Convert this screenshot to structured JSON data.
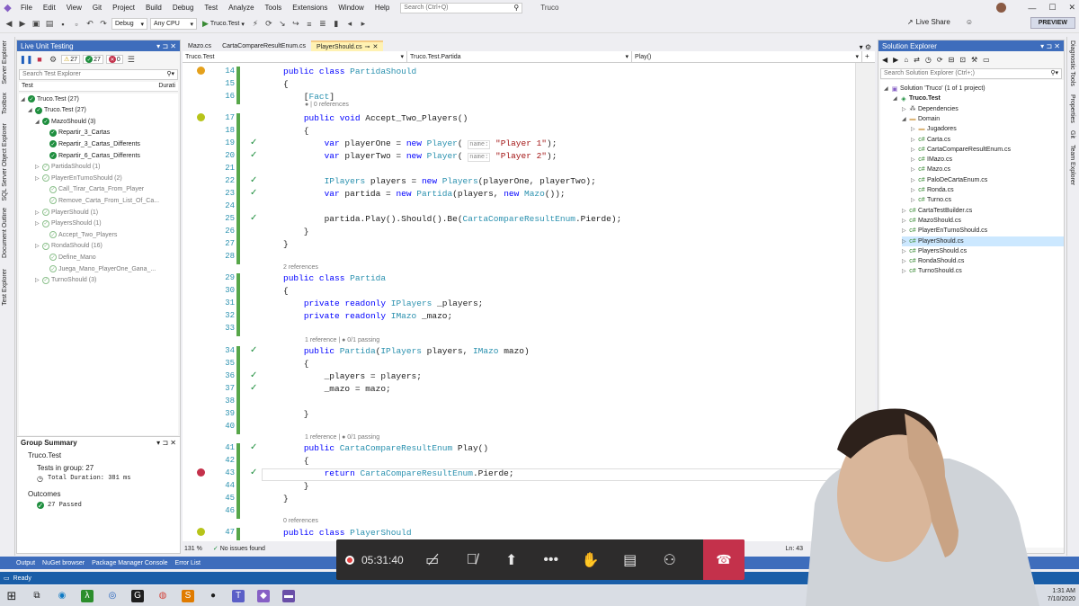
{
  "menubar": {
    "items": [
      "File",
      "Edit",
      "View",
      "Git",
      "Project",
      "Build",
      "Debug",
      "Test",
      "Analyze",
      "Tools",
      "Extensions",
      "Window",
      "Help"
    ],
    "search_placeholder": "Search (Ctrl+Q)",
    "solution": "Truco"
  },
  "toolbar": {
    "config": "Debug",
    "platform": "Any CPU",
    "run_target": "Truco.Test",
    "live_share": "Live Share",
    "preview": "PREVIEW"
  },
  "left_strip": [
    "Server Explorer",
    "Toolbox",
    "SQL Server Object Explorer",
    "Document Outline",
    "Test Explorer"
  ],
  "right_strip": [
    "Diagnostic Tools",
    "Properties",
    "Git",
    "Team Explorer"
  ],
  "lut": {
    "title": "Live Unit Testing",
    "counts": {
      "warn": "27",
      "pass": "27",
      "fail": "0"
    },
    "search_placeholder": "Search Test Explorer",
    "col_test": "Test",
    "col_duration": "Durati",
    "tree": [
      {
        "label": "Truco.Test (27)",
        "level": 0,
        "faded": false
      },
      {
        "label": "Truco.Test (27)",
        "level": 1,
        "faded": false
      },
      {
        "label": "MazoShould (3)",
        "level": 2,
        "faded": false
      },
      {
        "label": "Repartir_3_Cartas",
        "level": 3,
        "faded": false
      },
      {
        "label": "Repartir_3_Cartas_Differents",
        "level": 3,
        "faded": false
      },
      {
        "label": "Repartir_6_Cartas_Differents",
        "level": 3,
        "faded": false
      },
      {
        "label": "PartidaShould (1)",
        "level": 2,
        "faded": true
      },
      {
        "label": "PlayerEnTurnoShould (2)",
        "level": 2,
        "faded": true
      },
      {
        "label": "Call_Tirar_Carta_From_Player",
        "level": 3,
        "faded": true
      },
      {
        "label": "Remove_Carta_From_List_Of_Ca...",
        "level": 3,
        "faded": true
      },
      {
        "label": "PlayerShould (1)",
        "level": 2,
        "faded": true
      },
      {
        "label": "PlayersShould (1)",
        "level": 2,
        "faded": true
      },
      {
        "label": "Accept_Two_Players",
        "level": 3,
        "faded": true
      },
      {
        "label": "RondaShould (16)",
        "level": 2,
        "faded": true
      },
      {
        "label": "Define_Mano",
        "level": 3,
        "faded": true
      },
      {
        "label": "Juega_Mano_PlayerOne_Gana_...",
        "level": 3,
        "faded": true
      },
      {
        "label": "TurnoShould (3)",
        "level": 2,
        "faded": true
      }
    ],
    "summary": {
      "title": "Group Summary",
      "group": "Truco.Test",
      "tests_in_group": "Tests in group: 27",
      "duration": "Total Duration: 381 ms",
      "outcomes": "Outcomes",
      "passed": "27 Passed"
    }
  },
  "doc_tabs": [
    "Mazo.cs",
    "CartaCompareResultEnum.cs",
    "PlayerShould.cs"
  ],
  "nav": {
    "project": "Truco.Test",
    "class": "Truco.Test.Partida",
    "member": "Play()"
  },
  "code": [
    {
      "ln": "14",
      "html": "public class PartidaShould"
    },
    {
      "ln": "15",
      "html": "{"
    },
    {
      "ln": "16",
      "html": "    [Fact]"
    },
    {
      "ln": "17",
      "html": "    public void Accept_Two_Players()"
    },
    {
      "ln": "18",
      "html": "    {"
    },
    {
      "ln": "19",
      "html": "        var playerOne = new Player( name: \"Player 1\");"
    },
    {
      "ln": "20",
      "html": "        var playerTwo = new Player( name: \"Player 2\");"
    },
    {
      "ln": "21",
      "html": ""
    },
    {
      "ln": "22",
      "html": "        IPlayers players = new Players(playerOne, playerTwo);"
    },
    {
      "ln": "23",
      "html": "        var partida = new Partida(players, new Mazo());"
    },
    {
      "ln": "24",
      "html": ""
    },
    {
      "ln": "25",
      "html": "        partida.Play().Should().Be(CartaCompareResultEnum.Pierde);"
    },
    {
      "ln": "26",
      "html": "    }"
    },
    {
      "ln": "27",
      "html": "}"
    },
    {
      "ln": "28",
      "html": ""
    },
    {
      "ln": "29",
      "html": "public class Partida"
    },
    {
      "ln": "30",
      "html": "{"
    },
    {
      "ln": "31",
      "html": "    private readonly IPlayers _players;"
    },
    {
      "ln": "32",
      "html": "    private readonly IMazo _mazo;"
    },
    {
      "ln": "33",
      "html": ""
    },
    {
      "ln": "34",
      "html": "    public Partida(IPlayers players, IMazo mazo)"
    },
    {
      "ln": "35",
      "html": "    {"
    },
    {
      "ln": "36",
      "html": "        _players = players;"
    },
    {
      "ln": "37",
      "html": "        _mazo = mazo;"
    },
    {
      "ln": "38",
      "html": ""
    },
    {
      "ln": "39",
      "html": "    }"
    },
    {
      "ln": "40",
      "html": ""
    },
    {
      "ln": "41",
      "html": "    public CartaCompareResultEnum Play()"
    },
    {
      "ln": "42",
      "html": "    {"
    },
    {
      "ln": "43",
      "html": "        return CartaCompareResultEnum.Pierde;"
    },
    {
      "ln": "44",
      "html": "    }"
    },
    {
      "ln": "45",
      "html": "}"
    },
    {
      "ln": "46",
      "html": ""
    },
    {
      "ln": "47",
      "html": "public class PlayerShould"
    }
  ],
  "lenses": {
    "l16": "● | 0 references",
    "l29": "2 references",
    "l34": "1 reference | ● 0/1 passing",
    "l41": "1 reference | ● 0/1 passing",
    "l47": "0 references"
  },
  "editor_status": {
    "zoom": "131 %",
    "issues": "No issues found",
    "line": "Ln: 43"
  },
  "solution_explorer": {
    "title": "Solution Explorer",
    "search_placeholder": "Search Solution Explorer (Ctrl+;)",
    "tree": [
      {
        "label": "Solution 'Truco' (1 of 1 project)",
        "level": 0,
        "icon": "solution",
        "sel": false
      },
      {
        "label": "Truco.Test",
        "level": 1,
        "icon": "project",
        "sel": false,
        "bold": true
      },
      {
        "label": "Dependencies",
        "level": 2,
        "icon": "deps",
        "sel": false
      },
      {
        "label": "Domain",
        "level": 2,
        "icon": "folder",
        "sel": false
      },
      {
        "label": "Jugadores",
        "level": 3,
        "icon": "folder",
        "sel": false
      },
      {
        "label": "Carta.cs",
        "level": 3,
        "icon": "cs",
        "sel": false
      },
      {
        "label": "CartaCompareResultEnum.cs",
        "level": 3,
        "icon": "cs",
        "sel": false
      },
      {
        "label": "IMazo.cs",
        "level": 3,
        "icon": "cs",
        "sel": false
      },
      {
        "label": "Mazo.cs",
        "level": 3,
        "icon": "cs",
        "sel": false
      },
      {
        "label": "PaloDeCartaEnum.cs",
        "level": 3,
        "icon": "cs",
        "sel": false
      },
      {
        "label": "Ronda.cs",
        "level": 3,
        "icon": "cs",
        "sel": false
      },
      {
        "label": "Turno.cs",
        "level": 3,
        "icon": "cs",
        "sel": false
      },
      {
        "label": "CartaTestBuilder.cs",
        "level": 2,
        "icon": "cs",
        "sel": false
      },
      {
        "label": "MazoShould.cs",
        "level": 2,
        "icon": "cs",
        "sel": false
      },
      {
        "label": "PlayerEnTurnoShould.cs",
        "level": 2,
        "icon": "cs",
        "sel": false
      },
      {
        "label": "PlayerShould.cs",
        "level": 2,
        "icon": "cs",
        "sel": true
      },
      {
        "label": "PlayersShould.cs",
        "level": 2,
        "icon": "cs",
        "sel": false
      },
      {
        "label": "RondaShould.cs",
        "level": 2,
        "icon": "cs",
        "sel": false
      },
      {
        "label": "TurnoShould.cs",
        "level": 2,
        "icon": "cs",
        "sel": false
      }
    ]
  },
  "bottom_tabs": [
    "Output",
    "NuGet browser",
    "Package Manager Console",
    "Error List"
  ],
  "status": {
    "ready": "Ready"
  },
  "meeting": {
    "timer": "05:31:40"
  },
  "clock": {
    "time": "1:31 AM",
    "date": "7/10/2020"
  }
}
